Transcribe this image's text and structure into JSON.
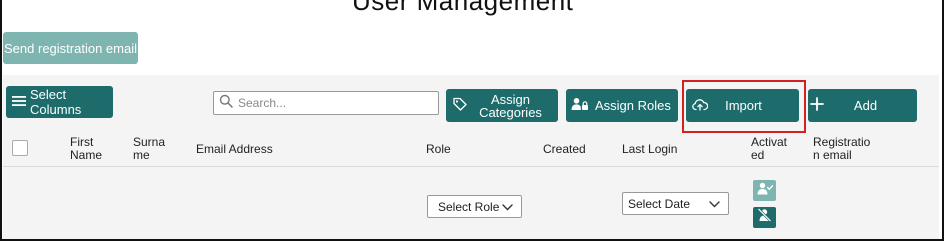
{
  "page": {
    "title": "User Management"
  },
  "toolbar": {
    "send_registration_label": "Send registration email",
    "select_columns_label": "Select Columns",
    "search_placeholder": "Search...",
    "assign_categories_label": "Assign Categories",
    "assign_roles_label": "Assign Roles",
    "import_label": "Import",
    "add_label": "Add"
  },
  "table": {
    "columns": [
      "First Name",
      "Surname",
      "Email Address",
      "Role",
      "Created",
      "Last Login",
      "Activated",
      "Registration email"
    ],
    "column_display": {
      "first_name": "First\nName",
      "surname": "Surna\nme",
      "email": "Email Address",
      "role": "Role",
      "created": "Created",
      "last_login": "Last Login",
      "activated": "Activat\ned",
      "registration_email": "Registratio\nn email"
    },
    "filters": {
      "role_label": "Select Role",
      "date_label": "Select Date"
    }
  },
  "colors": {
    "primary": "#1d6b6b",
    "primary_light": "#7fb5b1",
    "highlight": "#d32020"
  },
  "icons": {
    "select_columns": "menu-icon",
    "search": "search-icon",
    "assign_categories": "tag-icon",
    "assign_roles": "user-lock-icon",
    "import": "cloud-upload-icon",
    "add": "plus-icon",
    "activate": "user-check-icon",
    "deactivate": "user-slash-icon",
    "dropdown": "chevron-down-icon"
  }
}
